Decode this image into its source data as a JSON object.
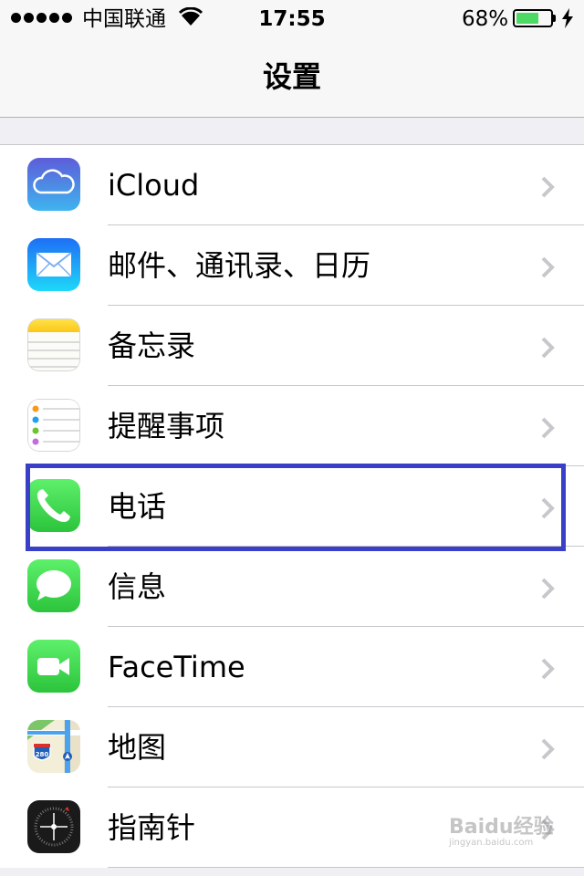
{
  "status_bar": {
    "carrier": "中国联通",
    "time": "17:55",
    "battery_percent": "68%",
    "battery_level": 0.68
  },
  "nav": {
    "title": "设置"
  },
  "settings_items": [
    {
      "label": "iCloud",
      "icon": "icloud-icon"
    },
    {
      "label": "邮件、通讯录、日历",
      "icon": "mail-icon"
    },
    {
      "label": "备忘录",
      "icon": "notes-icon"
    },
    {
      "label": "提醒事项",
      "icon": "reminders-icon"
    },
    {
      "label": "电话",
      "icon": "phone-icon",
      "highlighted": true
    },
    {
      "label": "信息",
      "icon": "messages-icon"
    },
    {
      "label": "FaceTime",
      "icon": "facetime-icon"
    },
    {
      "label": "地图",
      "icon": "maps-icon",
      "map_shield": "280"
    },
    {
      "label": "指南针",
      "icon": "compass-icon"
    }
  ],
  "watermark": {
    "text": "Baidu经验",
    "sub": "jingyan.baidu.com"
  },
  "colors": {
    "highlight": "#3a3fc8",
    "battery": "#4cd964",
    "phone": "#3ad14b"
  }
}
